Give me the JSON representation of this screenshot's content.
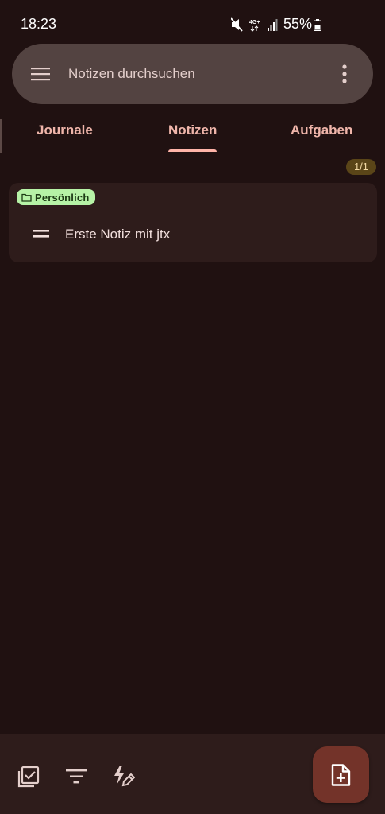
{
  "status_bar": {
    "time": "18:23",
    "battery_percent": "55%",
    "network": "4G+",
    "icons": [
      "mute-icon",
      "network-icon",
      "signal-icon",
      "battery-icon"
    ]
  },
  "search": {
    "placeholder": "Notizen durchsuchen",
    "menu_icon": "hamburger-menu-icon",
    "more_icon": "more-vertical-icon"
  },
  "tabs": [
    {
      "label": "Journale",
      "selected": false
    },
    {
      "label": "Notizen",
      "selected": true
    },
    {
      "label": "Aufgaben",
      "selected": false
    }
  ],
  "list": {
    "count_badge": "1/1",
    "items": [
      {
        "category": "Persönlich",
        "category_icon": "folder-icon",
        "title": "Erste Notiz mit jtx",
        "handle_icon": "drag-handle-icon"
      }
    ]
  },
  "bottom_bar": {
    "actions": [
      "checklist-icon",
      "filter-icon",
      "quick-edit-icon"
    ],
    "fab_icon": "add-note-icon"
  },
  "colors": {
    "background": "#201111",
    "accent": "#ffb4a8",
    "chip_bg": "#b6f2a6",
    "fab_bg": "#733329"
  }
}
